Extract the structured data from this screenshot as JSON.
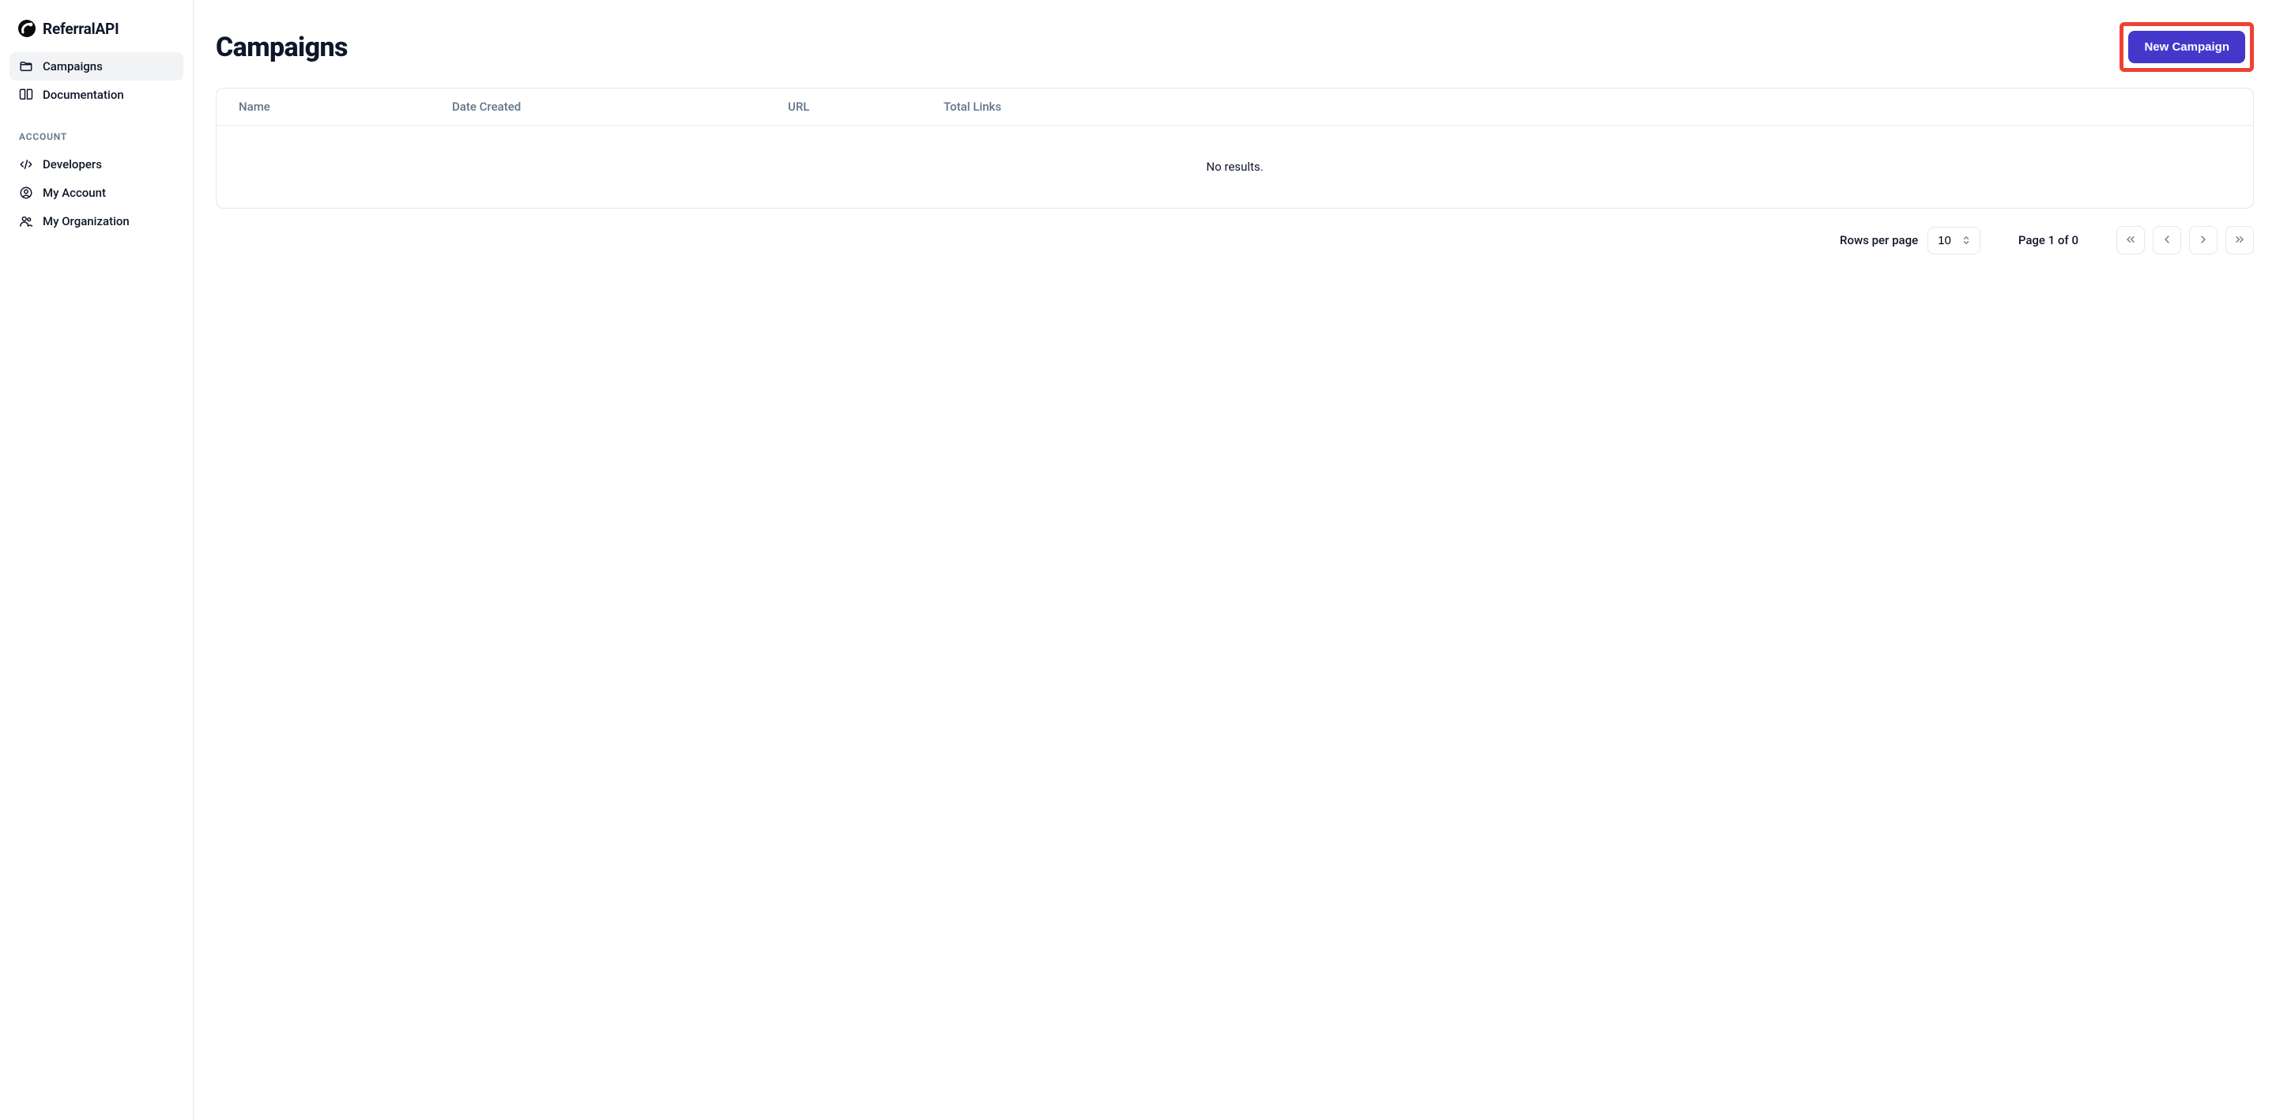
{
  "brand": {
    "name": "ReferralAPI"
  },
  "sidebar": {
    "items": [
      {
        "label": "Campaigns",
        "active": true
      },
      {
        "label": "Documentation",
        "active": false
      }
    ],
    "section_label": "ACCOUNT",
    "account_items": [
      {
        "label": "Developers"
      },
      {
        "label": "My Account"
      },
      {
        "label": "My Organization"
      }
    ]
  },
  "header": {
    "title": "Campaigns",
    "primary_button_label": "New Campaign"
  },
  "table": {
    "columns": [
      "Name",
      "Date Created",
      "URL",
      "Total Links"
    ],
    "empty_message": "No results."
  },
  "pagination": {
    "rows_label": "Rows per page",
    "rows_value": "10",
    "page_indicator": "Page 1 of 0"
  },
  "colors": {
    "primary": "#4338ca",
    "highlight_border": "#ef4132",
    "border": "#e5e7eb",
    "muted": "#64748b"
  }
}
